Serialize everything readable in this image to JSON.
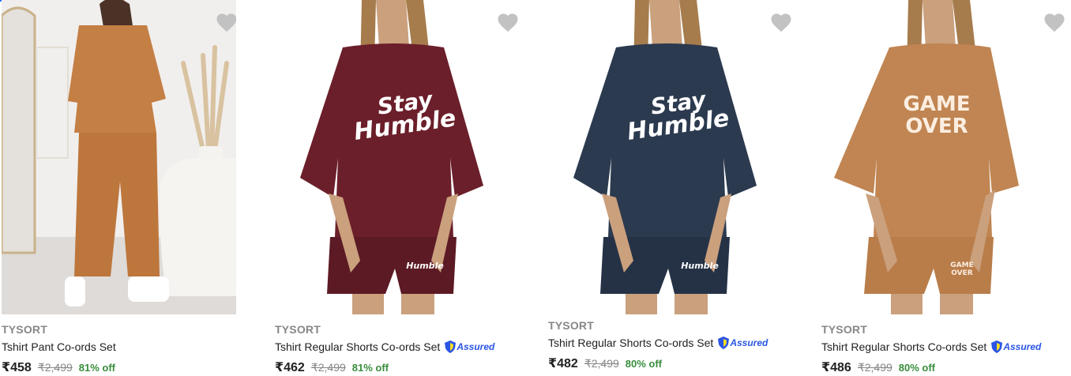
{
  "colors": {
    "brand_gray": "#878787",
    "discount_green": "#388e3c",
    "assured_blue": "#2a55e5",
    "wishlist_gray": "#c2c2c2"
  },
  "products": [
    {
      "brand": "TYSORT",
      "title": "Tshirt Pant Co-ords Set",
      "price": "₹458",
      "mrp": "₹2,499",
      "discount": "81% off",
      "assured": false,
      "print_text": ""
    },
    {
      "brand": "TYSORT",
      "title": "Tshirt Regular Shorts Co-ords Set",
      "price": "₹462",
      "mrp": "₹2,499",
      "discount": "81% off",
      "assured": true,
      "assured_label": "Assured",
      "print_text": "Stay Humble",
      "tshirt_color": "#6b1f2a"
    },
    {
      "brand": "TYSORT",
      "title": "Tshirt Regular Shorts Co-ords Set",
      "price": "₹482",
      "mrp": "₹2,499",
      "discount": "80% off",
      "assured": true,
      "assured_label": "Assured",
      "print_text": "Stay Humble",
      "tshirt_color": "#2c3a4f"
    },
    {
      "brand": "TYSORT",
      "title": "Tshirt Regular Shorts Co-ords Set",
      "price": "₹486",
      "mrp": "₹2,499",
      "discount": "80% off",
      "assured": true,
      "assured_label": "Assured",
      "print_text": "GAME OVER",
      "tshirt_color": "#c08552"
    }
  ]
}
